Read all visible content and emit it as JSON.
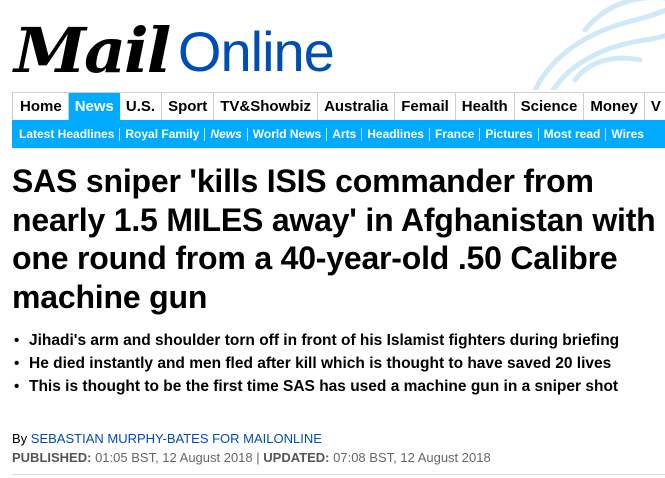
{
  "masthead": {
    "brand_mail": "Mail",
    "brand_online": "Online",
    "brand_color": "#004db3"
  },
  "nav_primary": [
    {
      "label": "Home",
      "active": false
    },
    {
      "label": "News",
      "active": true
    },
    {
      "label": "U.S.",
      "active": false
    },
    {
      "label": "Sport",
      "active": false
    },
    {
      "label": "TV&Showbiz",
      "active": false
    },
    {
      "label": "Australia",
      "active": false
    },
    {
      "label": "Femail",
      "active": false
    },
    {
      "label": "Health",
      "active": false
    },
    {
      "label": "Science",
      "active": false
    },
    {
      "label": "Money",
      "active": false
    },
    {
      "label": "V",
      "active": false
    }
  ],
  "nav_secondary": [
    {
      "label": "Latest Headlines",
      "active": false
    },
    {
      "label": "Royal Family",
      "active": false
    },
    {
      "label": "News",
      "active": true
    },
    {
      "label": "World News",
      "active": false
    },
    {
      "label": "Arts",
      "active": false
    },
    {
      "label": "Headlines",
      "active": false
    },
    {
      "label": "France",
      "active": false
    },
    {
      "label": "Pictures",
      "active": false
    },
    {
      "label": "Most read",
      "active": false
    },
    {
      "label": "Wires",
      "active": false
    }
  ],
  "accent_color": "#00aaff",
  "article": {
    "headline": "SAS sniper 'kills ISIS commander from nearly 1.5 MILES away' in Afghanistan with one round from a 40-year-old .50 Calibre machine gun",
    "bullets": [
      "Jihadi's arm and shoulder torn off in front of his Islamist fighters during briefing",
      "He died instantly and men fled after kill which is thought to have saved 20 lives",
      "This is thought to be the first time SAS has used a machine gun in a sniper shot"
    ],
    "byline_prefix": "By",
    "author": "SEBASTIAN MURPHY-BATES FOR MAILONLINE",
    "published_label": "PUBLISHED:",
    "published_value": "01:05 BST, 12 August 2018",
    "separator": "|",
    "updated_label": "UPDATED:",
    "updated_value": "07:08 BST, 12 August 2018"
  }
}
